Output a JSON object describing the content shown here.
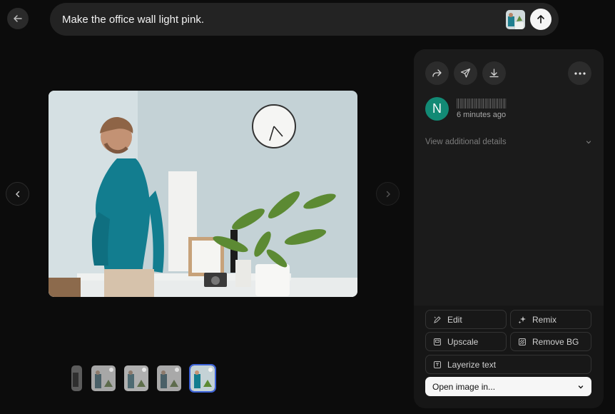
{
  "prompt": {
    "text": "Make the office wall light pink."
  },
  "panel": {
    "avatar_initial": "N",
    "timestamp": "6 minutes ago",
    "details_label": "View additional details",
    "actions": {
      "edit": "Edit",
      "remix": "Remix",
      "upscale": "Upscale",
      "remove_bg": "Remove BG",
      "layerize": "Layerize text",
      "open_image": "Open image in..."
    }
  },
  "colors": {
    "accent_selected": "#3d63d8",
    "avatar": "#128a75"
  }
}
